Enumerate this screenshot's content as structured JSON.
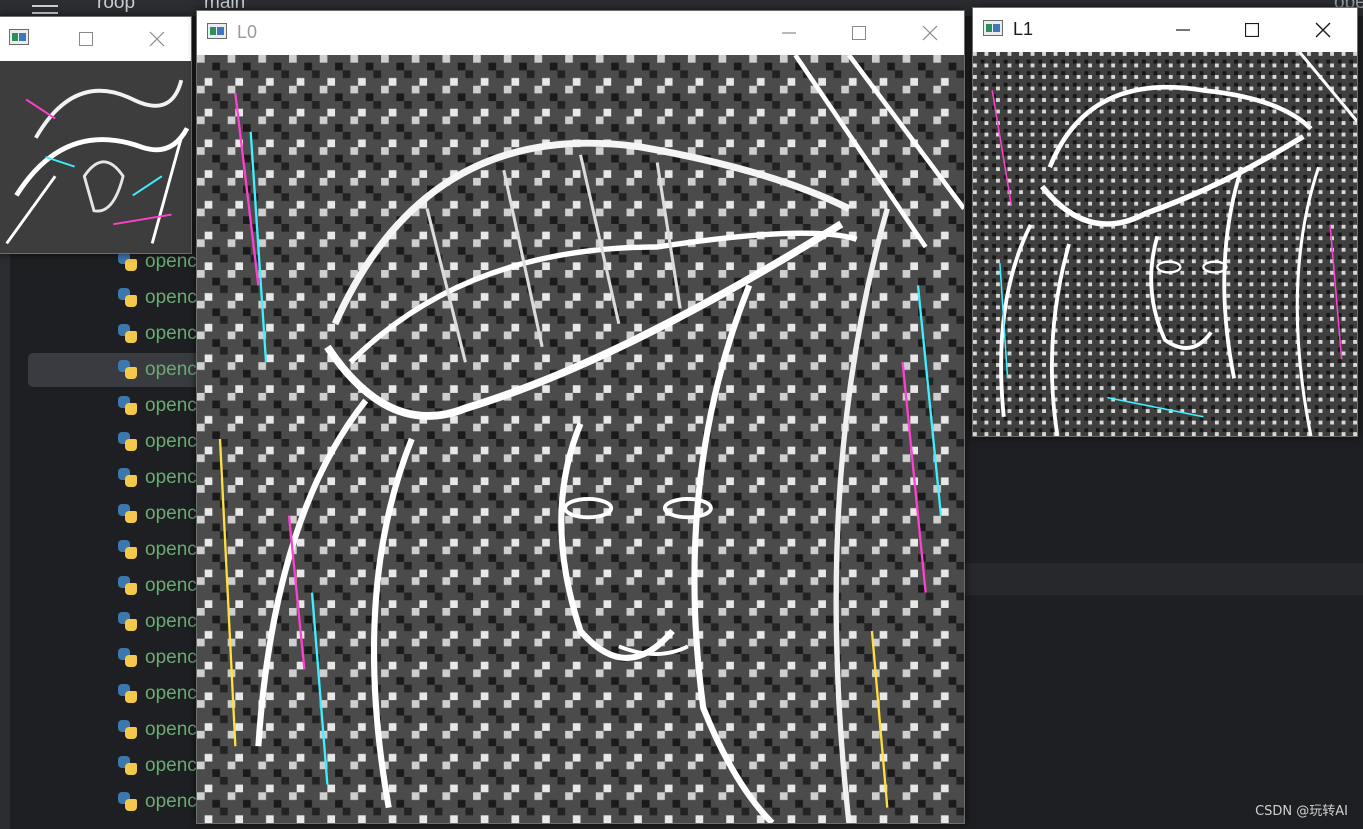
{
  "ide": {
    "project_name": "roop",
    "branch_name": "main",
    "right_edge_text": "ope",
    "files": [
      {
        "label": "openc"
      },
      {
        "label": "openc"
      },
      {
        "label": "openc"
      },
      {
        "label": "openc"
      },
      {
        "label": "openc"
      },
      {
        "label": "openc"
      },
      {
        "label": "openc"
      },
      {
        "label": "openc"
      },
      {
        "label": "openc"
      },
      {
        "label": "openc"
      },
      {
        "label": "openc"
      },
      {
        "label": "openc"
      },
      {
        "label": "openc"
      },
      {
        "label": "openc"
      },
      {
        "label": "openc"
      },
      {
        "label": "openc"
      }
    ],
    "selected_index": 3
  },
  "windows": {
    "small": {
      "title": ""
    },
    "l0": {
      "title": "L0",
      "active": false
    },
    "l1": {
      "title": "L1",
      "active": true
    }
  },
  "colors": {
    "ide_bg": "#1e1f22",
    "file_label": "#6aab73",
    "edge_image_bg": "#4a4a4a"
  },
  "watermark": "CSDN @玩转AI"
}
